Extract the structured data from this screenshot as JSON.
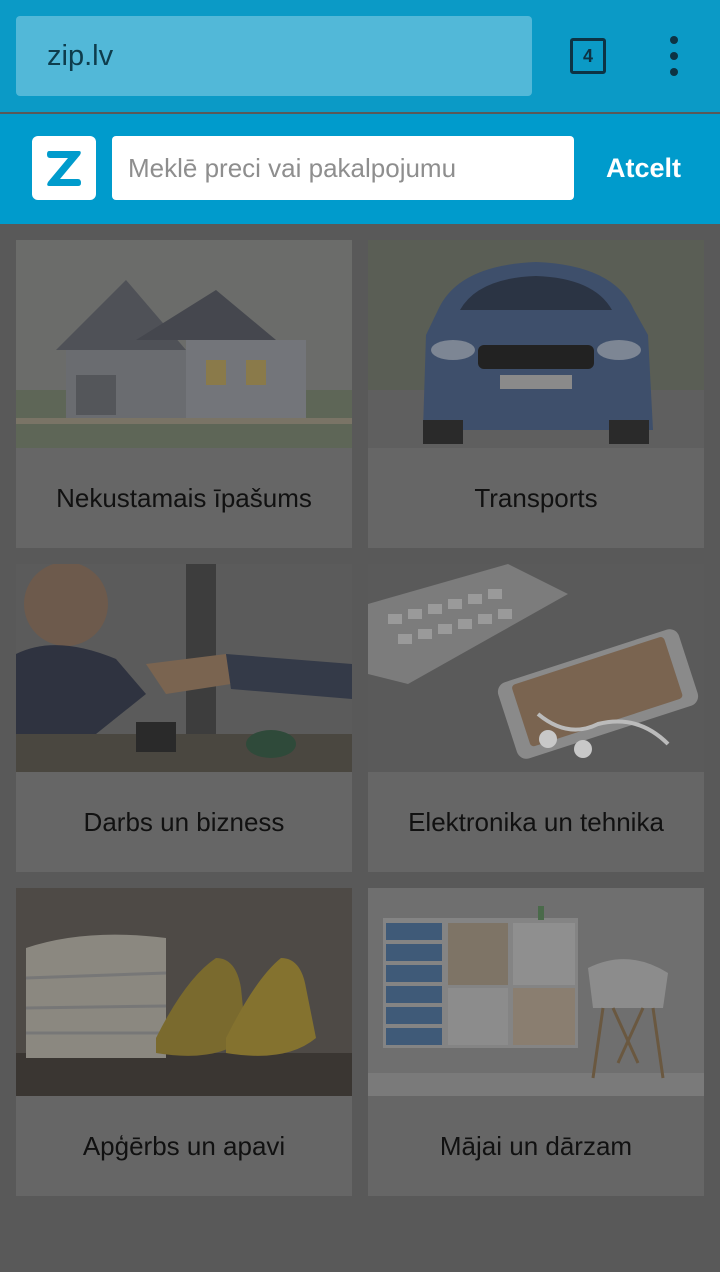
{
  "browser": {
    "url": "zip.lv",
    "tab_count": "4",
    "menu_icon": "more-vert-icon"
  },
  "header": {
    "logo_letter": "Z",
    "search_placeholder": "Meklē preci vai pakalpojumu",
    "cancel_label": "Atcelt"
  },
  "categories": [
    {
      "label": "Nekustamais īpašums",
      "image": "house-image"
    },
    {
      "label": "Transports",
      "image": "car-image"
    },
    {
      "label": "Darbs un bizness",
      "image": "handshake-image"
    },
    {
      "label": "Elektronika un tehnika",
      "image": "keyboard-phone-image"
    },
    {
      "label": "Apģērbs un apavi",
      "image": "clothes-shoes-image"
    },
    {
      "label": "Mājai un dārzam",
      "image": "interior-image"
    }
  ],
  "colors": {
    "browser_bar": "#0b9ac6",
    "header": "#009bcc",
    "overlay_background": "#595959",
    "card": "#666666"
  }
}
